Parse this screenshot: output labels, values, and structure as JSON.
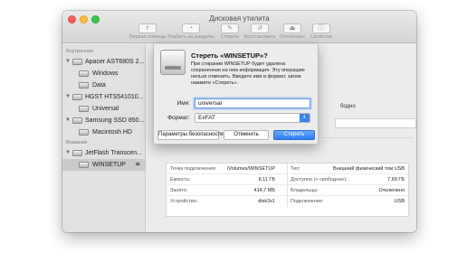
{
  "window": {
    "title": "Дисковая утилита"
  },
  "toolbar": {
    "items": [
      {
        "label": "Первая помощь",
        "icon": "stethoscope-icon"
      },
      {
        "label": "Разбить на разделы",
        "icon": "partition-icon"
      },
      {
        "label": "Стереть",
        "icon": "erase-icon"
      },
      {
        "label": "Восстановить",
        "icon": "restore-icon"
      },
      {
        "label": "Отключить",
        "icon": "unmount-icon"
      },
      {
        "label": "Свойства",
        "icon": "info-icon"
      }
    ]
  },
  "sidebar": {
    "internal_header": "Внутренние",
    "external_header": "Внешние",
    "items": [
      {
        "label": "Apacer AST680S 2..."
      },
      {
        "label": "Windows"
      },
      {
        "label": "Data"
      },
      {
        "label": "HGST HTS541010..."
      },
      {
        "label": "Universal"
      },
      {
        "label": "Samsung SSD 850..."
      },
      {
        "label": "Macintosh HD"
      },
      {
        "label": "JetFlash Transcen..."
      },
      {
        "label": "WINSETUP"
      }
    ]
  },
  "sheet": {
    "title": "Стереть «WINSETUP»?",
    "description": "При стирании WINSETUP будет удалена сохраненная на нем информация. Эту операцию нельзя отменить. Введите имя и формат, затем нажмите «Стереть».",
    "name_label": "Имя:",
    "name_value": "universal",
    "format_label": "Формат:",
    "format_value": "ExFAT",
    "security_button": "Параметры безопасности...",
    "cancel_button": "Отменить",
    "erase_button": "Стереть"
  },
  "background": {
    "free_hint": "бодно"
  },
  "info": {
    "rows": [
      {
        "l1": "Точка подключения:",
        "v1": "/Volumes/WINSETUP",
        "l2": "Тип:",
        "v2": "Внешний физический том USB"
      },
      {
        "l1": "Емкость:",
        "v1": "8,11 ГБ",
        "l2": "Доступно (+ свободное):",
        "v2": "7,69 ГБ"
      },
      {
        "l1": "Занято:",
        "v1": "414,7 МБ",
        "l2": "Владельцы:",
        "v2": "Отключено"
      },
      {
        "l1": "Устройство:",
        "v1": "disk3s1",
        "l2": "Подключение:",
        "v2": "USB"
      }
    ]
  },
  "colors": {
    "accent": "#2d7ff0",
    "close": "#fc605c",
    "minimize": "#fdbc40",
    "maximize": "#34c84a"
  }
}
